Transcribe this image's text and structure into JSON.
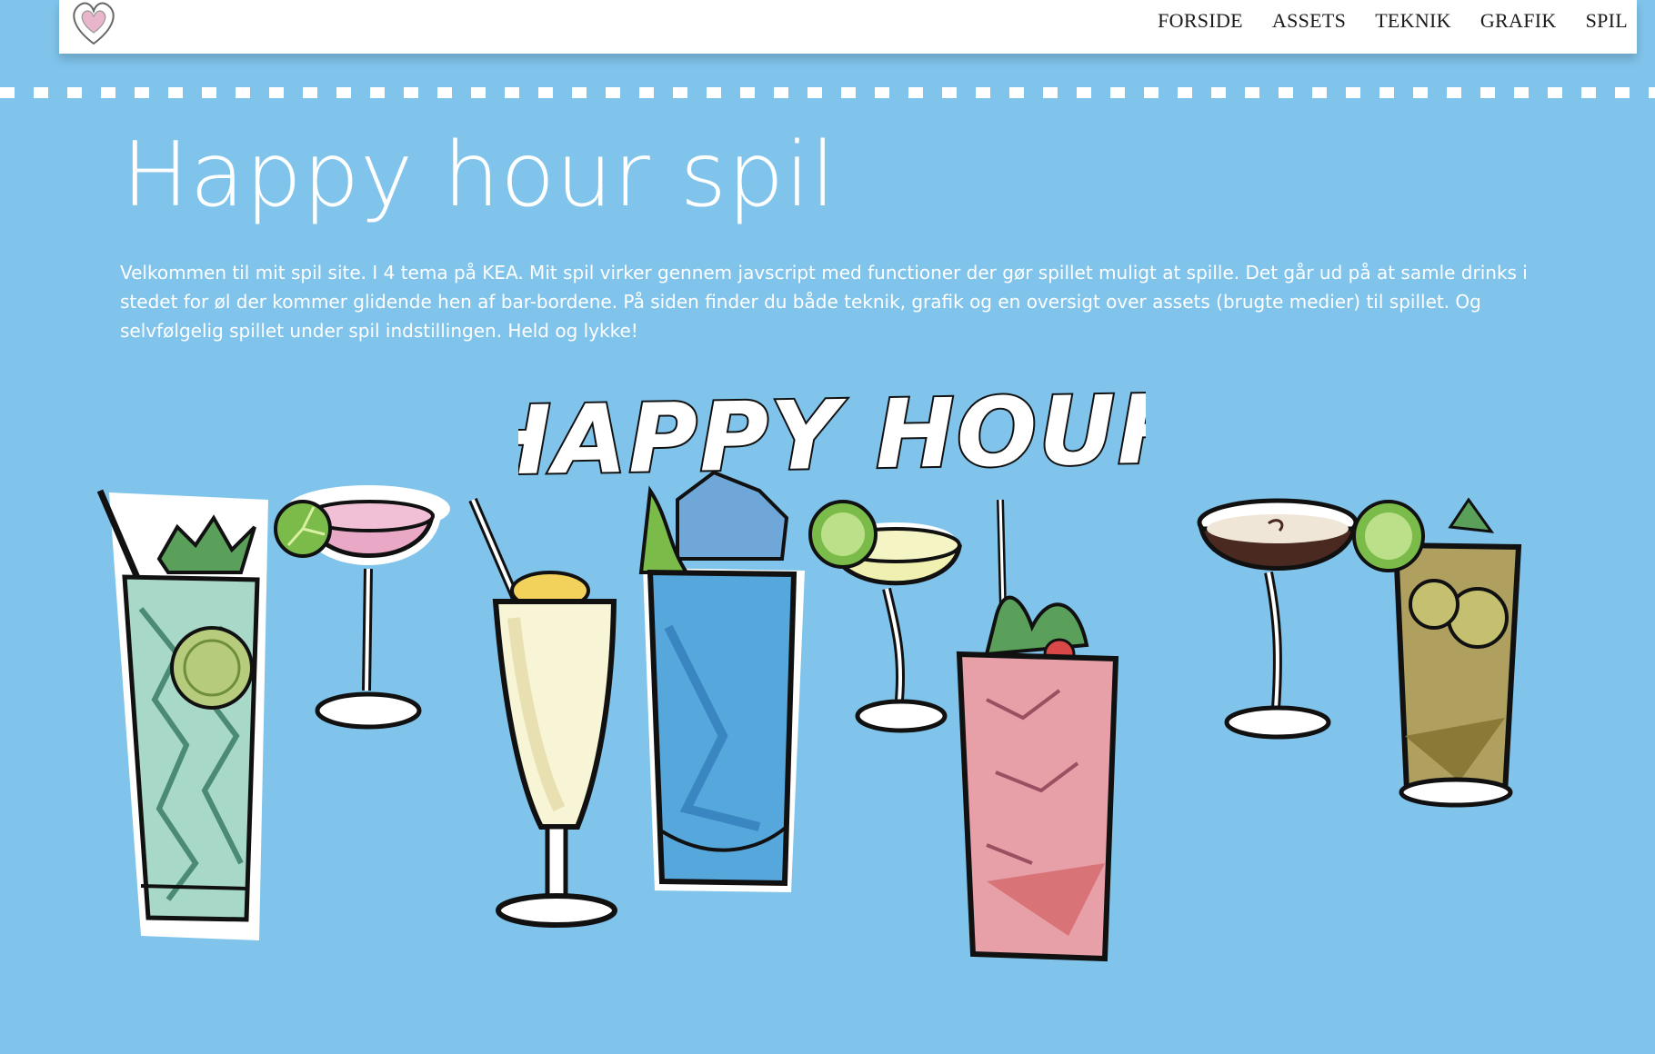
{
  "nav": {
    "logo_icon": "heart-icon",
    "links": [
      "FORSIDE",
      "ASSETS",
      "TEKNIK",
      "GRAFIK",
      "SPIL"
    ]
  },
  "page": {
    "title": "Happy hour spil",
    "intro": "Velkommen til mit spil site. I 4 tema på KEA. Mit spil virker gennem javscript med functioner der gør spillet muligt at spille. Det går ud på at samle drinks i stedet for øl der kommer glidende hen af bar-bordene. På siden finder du både teknik, grafik og en oversigt over assets (brugte medier) til spillet. Og selvfølgelig spillet under spil indstillingen. Held og lykke!"
  },
  "illustration": {
    "heading": "HAPPY HOUR",
    "drinks": [
      "mojito",
      "cosmopolitan",
      "pina-colada",
      "blue-lagoon",
      "margarita",
      "strawberry-mojito",
      "espresso-martini",
      "lime-cocktail"
    ]
  },
  "colors": {
    "background": "#80c4ec",
    "navbar": "#ffffff",
    "heart": "#e9b5cb"
  }
}
